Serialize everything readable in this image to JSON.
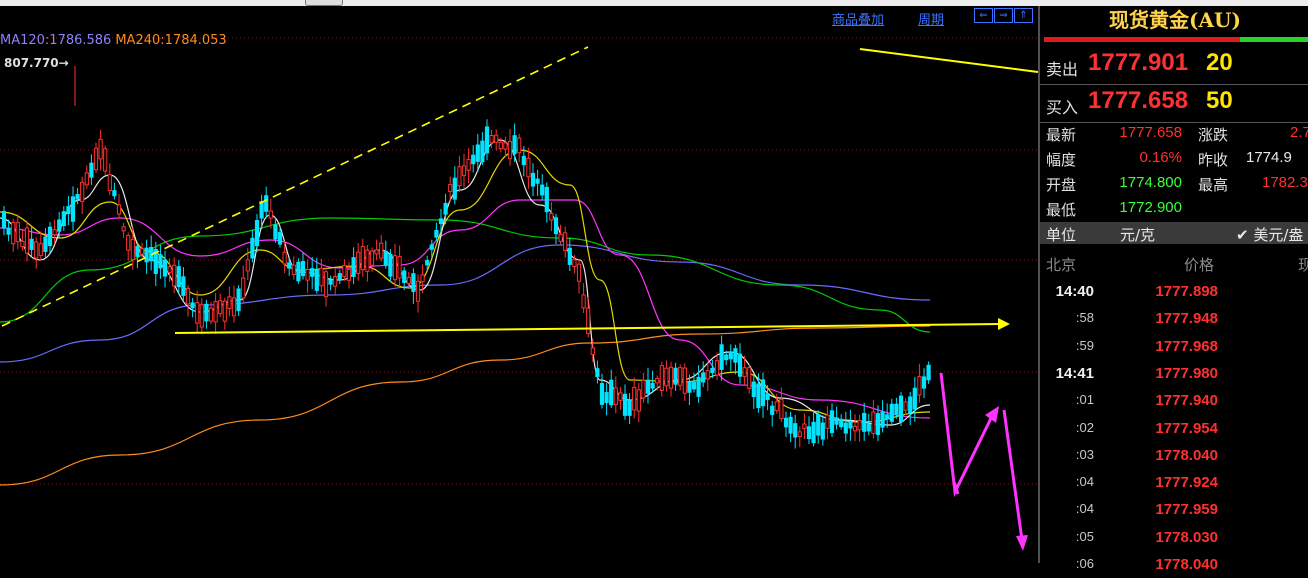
{
  "toolbar": {
    "overlay_label": "商品叠加",
    "period_label": "周期",
    "nav": [
      "⇐",
      "⇒",
      "⇑"
    ]
  },
  "legend": {
    "ma120": "MA120:1786.586",
    "ma240": "MA240:1784.053"
  },
  "chart_high_label": "807.770→",
  "colors": {
    "up": "#00e5ff",
    "down": "#ff3030",
    "ma5": "#e8e8e8",
    "ma10": "#e6d800",
    "ma20": "#ff33ff",
    "ma60": "#00cc00",
    "ma120": "#6b6bff",
    "ma240": "#ff8c1a",
    "trendline": "#ffff00",
    "arrow": "#ff33ff"
  },
  "panel": {
    "title": "现货黄金(AU)",
    "sell": {
      "label": "卖出",
      "price": "1777.901",
      "volume": "20"
    },
    "buy": {
      "label": "买入",
      "price": "1777.658",
      "volume": "50"
    },
    "stats": {
      "latest_label": "最新",
      "latest": "1777.658",
      "change_label": "涨跌",
      "change": "2.7",
      "amplitude_label": "幅度",
      "amplitude": "0.16%",
      "prev_close_label": "昨收",
      "prev_close": "1774.9",
      "open_label": "开盘",
      "open": "1774.800",
      "high_label": "最高",
      "high": "1782.3",
      "low_label": "最低",
      "low": "1772.900"
    },
    "unit_label": "单位",
    "unit_value": "元/克",
    "unit_check": "✔ 美元/盎",
    "header": {
      "time": "北京",
      "price": "价格",
      "vol": "现"
    },
    "ticks": [
      {
        "time": "14:40",
        "price": "1777.898",
        "big": true
      },
      {
        "time": ":58",
        "price": "1777.948",
        "big": false
      },
      {
        "time": ":59",
        "price": "1777.968",
        "big": false
      },
      {
        "time": "14:41",
        "price": "1777.980",
        "big": true
      },
      {
        "time": ":01",
        "price": "1777.940",
        "big": false
      },
      {
        "time": ":02",
        "price": "1777.954",
        "big": false
      },
      {
        "time": ":03",
        "price": "1778.040",
        "big": false
      },
      {
        "time": ":04",
        "price": "1777.924",
        "big": false
      },
      {
        "time": ":04",
        "price": "1777.959",
        "big": false
      },
      {
        "time": ":05",
        "price": "1778.030",
        "big": false
      },
      {
        "time": ":06",
        "price": "1778.040",
        "big": false
      }
    ]
  }
}
